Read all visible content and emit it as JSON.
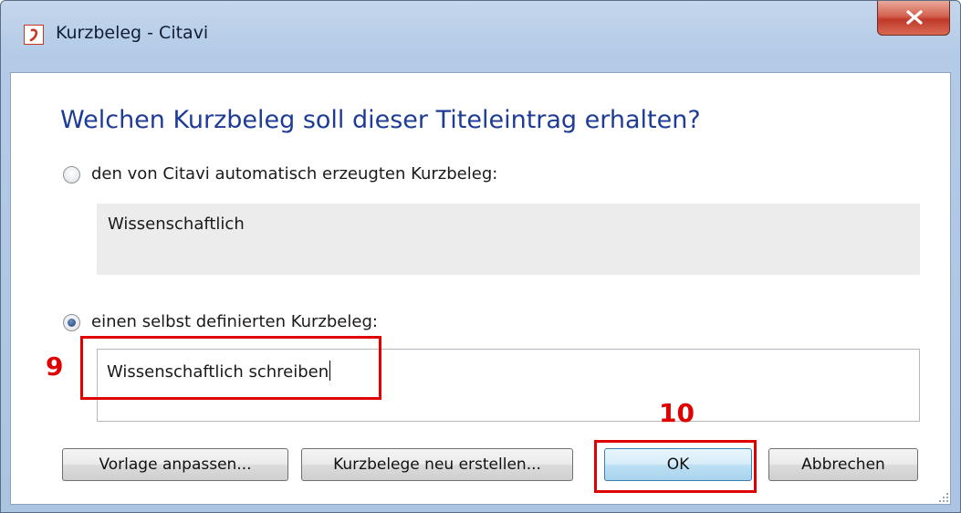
{
  "window": {
    "title": "Kurzbeleg - Citavi",
    "icon": "citavi-app-icon",
    "close_icon": "close-icon",
    "close_color": "#c0392b"
  },
  "dialog": {
    "heading": "Welchen Kurzbeleg soll dieser Titeleintrag erhalten?",
    "option_auto": {
      "label": "den von Citavi automatisch erzeugten Kurzbeleg:",
      "selected": false
    },
    "auto_value": "Wissenschaftlich",
    "option_custom": {
      "label": "einen selbst definierten Kurzbeleg:",
      "selected": true
    },
    "custom_value": "Wissenschaftlich schreiben"
  },
  "buttons": {
    "template": "Vorlage anpassen...",
    "regenerate": "Kurzbelege neu erstellen...",
    "ok": "OK",
    "cancel": "Abbrechen"
  },
  "annotations": {
    "step_9": "9",
    "step_10": "10",
    "color": "#e00000"
  },
  "colors": {
    "heading": "#1e3c96",
    "title_bar": "#b3cbe7"
  }
}
